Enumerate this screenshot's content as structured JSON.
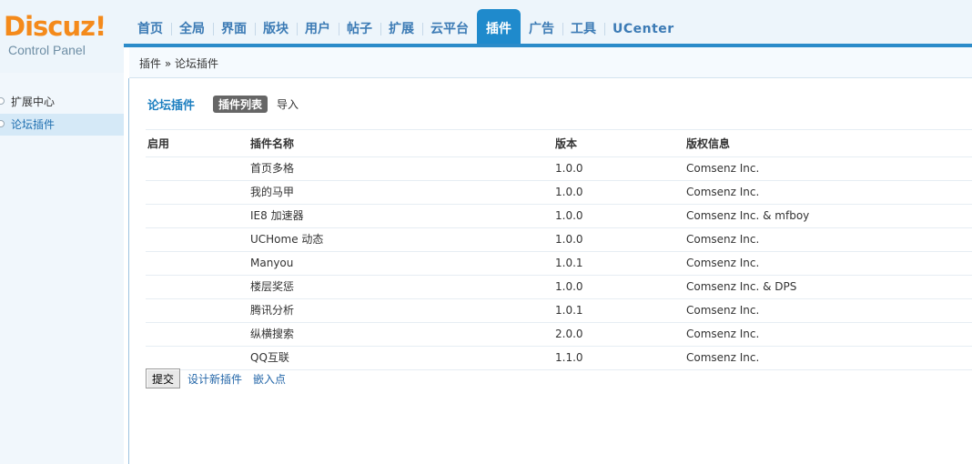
{
  "logo": {
    "brand": "Discuz",
    "bang": "!",
    "subtitle": "Control Panel"
  },
  "nav": {
    "items": [
      {
        "label": "首页"
      },
      {
        "label": "全局"
      },
      {
        "label": "界面"
      },
      {
        "label": "版块"
      },
      {
        "label": "用户"
      },
      {
        "label": "帖子"
      },
      {
        "label": "扩展"
      },
      {
        "label": "云平台"
      },
      {
        "label": "插件",
        "active": true
      },
      {
        "label": "广告"
      },
      {
        "label": "工具"
      },
      {
        "label": "UCenter"
      }
    ]
  },
  "breadcrumb": "插件 » 论坛插件",
  "sidebar": {
    "items": [
      {
        "label": "扩展中心"
      },
      {
        "label": "论坛插件",
        "active": true
      }
    ]
  },
  "main": {
    "title": "论坛插件",
    "tabs": [
      {
        "label": "插件列表",
        "active": true
      },
      {
        "label": "导入"
      }
    ],
    "table": {
      "headers": [
        "启用",
        "插件名称",
        "版本",
        "版权信息"
      ],
      "rows": [
        {
          "enabled": "",
          "name": "首页多格",
          "version": "1.0.0",
          "copyright": "Comsenz Inc."
        },
        {
          "enabled": "",
          "name": "我的马甲",
          "version": "1.0.0",
          "copyright": "Comsenz Inc."
        },
        {
          "enabled": "",
          "name": "IE8 加速器",
          "version": "1.0.0",
          "copyright": "Comsenz Inc. & mfboy"
        },
        {
          "enabled": "",
          "name": "UCHome 动态",
          "version": "1.0.0",
          "copyright": "Comsenz Inc."
        },
        {
          "enabled": "",
          "name": "Manyou",
          "version": "1.0.1",
          "copyright": "Comsenz Inc."
        },
        {
          "enabled": "",
          "name": "楼层奖惩",
          "version": "1.0.0",
          "copyright": "Comsenz Inc. & DPS"
        },
        {
          "enabled": "",
          "name": "腾讯分析",
          "version": "1.0.1",
          "copyright": "Comsenz Inc."
        },
        {
          "enabled": "",
          "name": "纵横搜索",
          "version": "2.0.0",
          "copyright": "Comsenz Inc."
        },
        {
          "enabled": "",
          "name": "QQ互联",
          "version": "1.1.0",
          "copyright": "Comsenz Inc."
        }
      ]
    },
    "actions": {
      "submit_label": "提交",
      "design_link": "设计新插件",
      "hooks_link": "嵌入点"
    }
  },
  "colors": {
    "accent": "#1f8acc",
    "logo_orange": "#f48a1b",
    "nav_text": "#3c7bb5"
  }
}
